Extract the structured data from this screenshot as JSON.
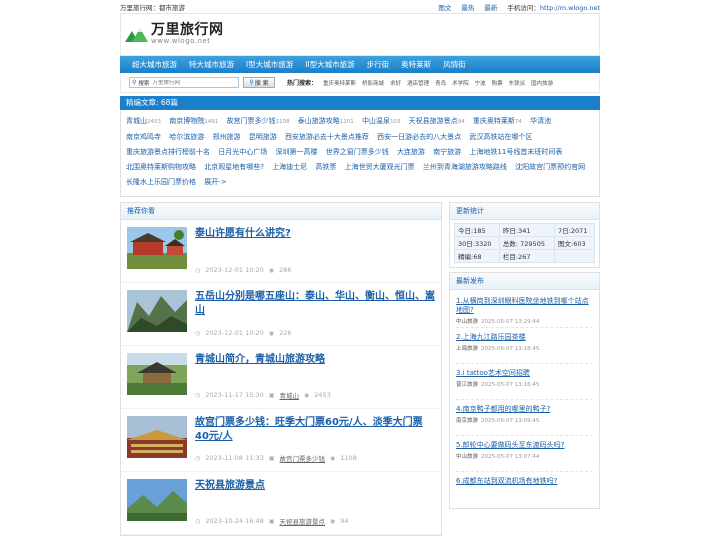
{
  "topbar": {
    "left_text": "万里旅行网：都市旅游",
    "links": [
      "图文",
      "最热",
      "最新"
    ],
    "mobile_label": "手机访问：",
    "mobile_url": "http://m.wlogo.net"
  },
  "logo": {
    "cn": "万里旅行网",
    "en": "www.wlogo.net"
  },
  "nav": [
    "超大城市旅游",
    "特大城市旅游",
    "I型大城市旅游",
    "II型大城市旅游",
    "步行街",
    "奥特莱斯",
    "风情街"
  ],
  "search": {
    "keyword_label": "搜索",
    "placeholder": "万里旅行网",
    "button_label": "搜 索",
    "hot_label": "热门搜索：",
    "hot_tags": [
      "重庆奥特莱斯",
      "桥影商城",
      "求好",
      "酒店管理",
      "青岛",
      "术学院",
      "宁波",
      "购票",
      "东铁派",
      "国内旅游"
    ]
  },
  "featured": {
    "title": "精编文章: 68篇",
    "items": [
      {
        "name": "青城山",
        "count": "2453"
      },
      {
        "name": "南京博物院",
        "count": "1491"
      },
      {
        "name": "故宫门票多少钱",
        "count": "1108"
      },
      {
        "name": "泰山旅游攻略",
        "count": "1101"
      },
      {
        "name": "中山温泉",
        "count": "103"
      },
      {
        "name": "天祝县旅游景点",
        "count": "94"
      },
      {
        "name": "重庆奥特莱斯",
        "count": "74"
      },
      {
        "name": "华清池",
        "count": ""
      },
      {
        "name": "南京鸡鸣寺",
        "count": ""
      },
      {
        "name": "哈尔滨旅游",
        "count": ""
      },
      {
        "name": "郑州旅游",
        "count": ""
      },
      {
        "name": "昆明旅游",
        "count": ""
      },
      {
        "name": "西安旅游必去十大景点推荐",
        "count": ""
      },
      {
        "name": "西安一日游必去的八大景点",
        "count": ""
      },
      {
        "name": "武汉高铁站在哪个区",
        "count": ""
      },
      {
        "name": "重庆旅游景点排行榜前十名",
        "count": ""
      },
      {
        "name": "日月光中心广场",
        "count": ""
      },
      {
        "name": "深圳第一高楼",
        "count": ""
      },
      {
        "name": "世界之窗门票多少钱",
        "count": ""
      },
      {
        "name": "大连旅游",
        "count": ""
      },
      {
        "name": "南宁旅游",
        "count": ""
      },
      {
        "name": "上海地铁11号线首末班时间表",
        "count": ""
      },
      {
        "name": "北围奥特莱斯购物攻略",
        "count": ""
      },
      {
        "name": "北京观星地有哪些?",
        "count": ""
      },
      {
        "name": "上海迪士尼",
        "count": ""
      },
      {
        "name": "高铁票",
        "count": ""
      },
      {
        "name": "上海世贸大厦观光门票",
        "count": ""
      },
      {
        "name": "兰州到青海湖旅游攻略路线",
        "count": ""
      },
      {
        "name": "沈阳故宫门票预约官网",
        "count": ""
      },
      {
        "name": "长隆水上乐园门票价格",
        "count": ""
      },
      {
        "name": "展开->",
        "count": ""
      }
    ]
  },
  "recommend": {
    "title": "推荐你看",
    "articles": [
      {
        "title": "泰山许愿有什么讲究?",
        "date": "2023-12-01 10:20",
        "category": "",
        "views": "286",
        "thumb": "temple"
      },
      {
        "title": "五岳山分别是哪五座山：泰山、华山、衡山、恒山、嵩山",
        "date": "2023-12-01 10:20",
        "category": "",
        "views": "226",
        "thumb": "mountain"
      },
      {
        "title": "青城山简介，青城山旅游攻略",
        "date": "2023-11-17 15:30",
        "category": "青城山",
        "views": "2453",
        "thumb": "pavilion"
      },
      {
        "title": "故宫门票多少钱：旺季大门票60元/人、淡季大门票40元/人",
        "date": "2023-11-08 11:33",
        "category": "故宫门票多少钱",
        "views": "1108",
        "thumb": "palace"
      },
      {
        "title": "天祝县旅游景点",
        "date": "2023-10-24 16:48",
        "category": "天祝县旅游景点",
        "views": "94",
        "thumb": "landscape"
      }
    ]
  },
  "stats": {
    "title": "更新统计",
    "rows": [
      [
        "今日:185",
        "昨日:341",
        "7日:2071"
      ],
      [
        "30日:3320",
        "总数: 729505",
        "图文:603"
      ],
      [
        "精编:68",
        "栏目:267",
        ""
      ]
    ]
  },
  "latest": {
    "title": "最新发布",
    "items": [
      {
        "title": "1.从横岗到深圳眼科医院坐地铁到哪个站点地图?",
        "source": "中山旅游",
        "date": "2025-05-07 13:29:44"
      },
      {
        "title": "2.上海九江路乐园茶楼",
        "source": "上海旅游",
        "date": "2025-05-07 13:18:45"
      },
      {
        "title": "3.i tattoo艺术空间招聘",
        "source": "普江旅游",
        "date": "2025-05-07 13:16:45"
      },
      {
        "title": "4.南京鸭子都用的哪里的鸭子?",
        "source": "南京旅游",
        "date": "2025-05-07 13:09:45"
      },
      {
        "title": "5.郎轮中心要做码头至东渡码头吗?",
        "source": "中山旅游",
        "date": "2025-05-07 13:07:44"
      },
      {
        "title": "6.成都东站到双流机场有地铁吗?",
        "source": "",
        "date": ""
      }
    ]
  },
  "colors": {
    "primary": "#1b7fc9",
    "link": "#1a5fa8",
    "logo_green": "#3aa84a"
  }
}
